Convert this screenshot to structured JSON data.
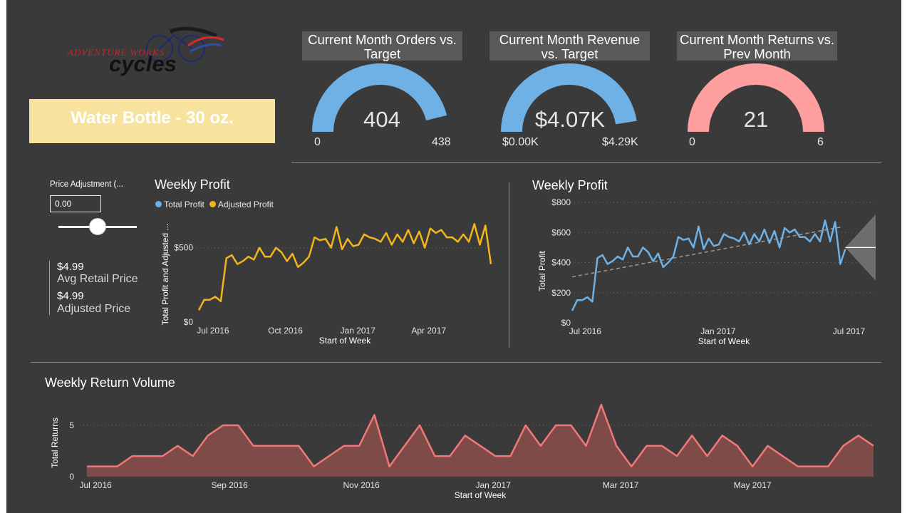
{
  "colors": {
    "background": "#3a3a3a",
    "orders_gauge": "#6fb1e4",
    "revenue_gauge": "#6fb1e4",
    "returns_gauge": "#ff9e9e",
    "banner": "#f8e39e",
    "adjusted_line": "#f2b51e",
    "total_line": "#6fb1e4",
    "returns_line": "#f07878",
    "returns_fill": "#7f4b48"
  },
  "logo": {
    "line1": "ADVENTURE WORKS",
    "line2": "cycles"
  },
  "banner": {
    "text": "Water Bottle - 30 oz."
  },
  "slicer": {
    "label": "Price Adjustment (...",
    "value": "0.00",
    "slider_fraction": 0.5
  },
  "cards": {
    "avg_retail_value": "$4.99",
    "avg_retail_label": "Avg Retail Price",
    "adjusted_value": "$4.99",
    "adjusted_label": "Adjusted Price"
  },
  "gauges": [
    {
      "title": "Current Month Orders vs. Target",
      "value_label": "404",
      "min_label": "0",
      "max_label": "438",
      "value": 404,
      "max": 438
    },
    {
      "title": "Current Month Revenue vs. Target",
      "value_label": "$4.07K",
      "min_label": "$0.00K",
      "max_label": "$4.29K",
      "value": 4.07,
      "max": 4.29
    },
    {
      "title": "Current Month Returns vs. Prev Month",
      "value_label": "21",
      "min_label": "0",
      "max_label": "6",
      "value": 21,
      "max": 6
    }
  ],
  "chart_data": [
    {
      "type": "line",
      "title": "Weekly Profit",
      "legend": [
        "Total Profit",
        "Adjusted Profit"
      ],
      "xlabel": "Start of Week",
      "ylabel": "Total Profit and Adjusted ...",
      "x_ticks": [
        "Jul 2016",
        "Oct 2016",
        "Jan 2017",
        "Apr 2017"
      ],
      "y_ticks": [
        "$0",
        "$500"
      ],
      "ylim": [
        0,
        700
      ],
      "x_range": [
        "2016-06-13",
        "2017-06-19"
      ],
      "x": [
        "2016-06-13",
        "2016-06-20",
        "2016-06-27",
        "2016-07-04",
        "2016-07-11",
        "2016-07-18",
        "2016-07-25",
        "2016-08-01",
        "2016-08-08",
        "2016-08-15",
        "2016-08-22",
        "2016-08-29",
        "2016-09-05",
        "2016-09-12",
        "2016-09-19",
        "2016-09-26",
        "2016-10-03",
        "2016-10-10",
        "2016-10-17",
        "2016-10-24",
        "2016-10-31",
        "2016-11-07",
        "2016-11-14",
        "2016-11-21",
        "2016-11-28",
        "2016-12-05",
        "2016-12-12",
        "2016-12-19",
        "2016-12-26",
        "2017-01-02",
        "2017-01-09",
        "2017-01-16",
        "2017-01-23",
        "2017-01-30",
        "2017-02-06",
        "2017-02-13",
        "2017-02-20",
        "2017-02-27",
        "2017-03-06",
        "2017-03-13",
        "2017-03-20",
        "2017-03-27",
        "2017-04-03",
        "2017-04-10",
        "2017-04-17",
        "2017-04-24",
        "2017-05-01",
        "2017-05-08",
        "2017-05-15",
        "2017-05-22",
        "2017-05-29",
        "2017-06-05",
        "2017-06-12",
        "2017-06-19"
      ],
      "series": [
        {
          "name": "Adjusted Profit",
          "values": [
            80,
            150,
            150,
            170,
            140,
            430,
            450,
            390,
            410,
            440,
            420,
            500,
            440,
            440,
            500,
            470,
            410,
            460,
            370,
            400,
            440,
            570,
            550,
            560,
            500,
            640,
            490,
            560,
            510,
            520,
            590,
            570,
            560,
            540,
            600,
            520,
            590,
            540,
            620,
            530,
            610,
            500,
            630,
            600,
            620,
            570,
            570,
            540,
            590,
            540,
            660,
            520,
            650,
            390
          ]
        }
      ]
    },
    {
      "type": "line",
      "title": "Weekly Profit",
      "xlabel": "Start of Week",
      "ylabel": "Total Profit",
      "x_ticks": [
        "Jul 2016",
        "Jan 2017",
        "Jul 2017"
      ],
      "y_ticks": [
        "$0",
        "$200",
        "$400",
        "$600",
        "$800"
      ],
      "ylim": [
        0,
        800
      ],
      "x_range": [
        "2016-06-13",
        "2017-08-07"
      ],
      "trendline": [
        {
          "x": "2016-06-13",
          "y": 305
        },
        {
          "x": "2017-06-19",
          "y": 635
        }
      ],
      "forecast": {
        "x_start": "2017-06-26",
        "x_end": "2017-08-07",
        "value": 500,
        "upper": 720,
        "lower": 280
      },
      "x": [
        "2016-06-13",
        "2016-06-20",
        "2016-06-27",
        "2016-07-04",
        "2016-07-11",
        "2016-07-18",
        "2016-07-25",
        "2016-08-01",
        "2016-08-08",
        "2016-08-15",
        "2016-08-22",
        "2016-08-29",
        "2016-09-05",
        "2016-09-12",
        "2016-09-19",
        "2016-09-26",
        "2016-10-03",
        "2016-10-10",
        "2016-10-17",
        "2016-10-24",
        "2016-10-31",
        "2016-11-07",
        "2016-11-14",
        "2016-11-21",
        "2016-11-28",
        "2016-12-05",
        "2016-12-12",
        "2016-12-19",
        "2016-12-26",
        "2017-01-02",
        "2017-01-09",
        "2017-01-16",
        "2017-01-23",
        "2017-01-30",
        "2017-02-06",
        "2017-02-13",
        "2017-02-20",
        "2017-02-27",
        "2017-03-06",
        "2017-03-13",
        "2017-03-20",
        "2017-03-27",
        "2017-04-03",
        "2017-04-10",
        "2017-04-17",
        "2017-04-24",
        "2017-05-01",
        "2017-05-08",
        "2017-05-15",
        "2017-05-22",
        "2017-05-29",
        "2017-06-05",
        "2017-06-12",
        "2017-06-19",
        "2017-06-26"
      ],
      "series": [
        {
          "name": "Total Profit",
          "values": [
            80,
            150,
            150,
            170,
            140,
            430,
            450,
            390,
            410,
            440,
            420,
            500,
            440,
            440,
            500,
            470,
            410,
            460,
            370,
            400,
            440,
            570,
            550,
            560,
            500,
            640,
            490,
            560,
            510,
            520,
            590,
            570,
            560,
            540,
            600,
            520,
            590,
            540,
            620,
            530,
            610,
            500,
            630,
            600,
            620,
            570,
            570,
            540,
            590,
            540,
            680,
            540,
            670,
            390,
            490
          ]
        }
      ]
    },
    {
      "type": "area",
      "title": "Weekly Return Volume",
      "xlabel": "Start of Week",
      "ylabel": "Total Returns",
      "x_ticks": [
        "Jul 2016",
        "Sep 2016",
        "Nov 2016",
        "Jan 2017",
        "Mar 2017",
        "May 2017"
      ],
      "y_ticks": [
        "0",
        "5"
      ],
      "ylim": [
        0,
        7
      ],
      "x_range": [
        "2016-06-27",
        "2017-06-26"
      ],
      "x": [
        "2016-06-27",
        "2016-07-04",
        "2016-07-11",
        "2016-07-18",
        "2016-07-25",
        "2016-08-01",
        "2016-08-08",
        "2016-08-15",
        "2016-08-22",
        "2016-08-29",
        "2016-09-05",
        "2016-09-12",
        "2016-09-19",
        "2016-09-26",
        "2016-10-03",
        "2016-10-10",
        "2016-10-17",
        "2016-10-24",
        "2016-10-31",
        "2016-11-07",
        "2016-11-14",
        "2016-11-21",
        "2016-11-28",
        "2016-12-05",
        "2016-12-12",
        "2016-12-19",
        "2016-12-26",
        "2017-01-02",
        "2017-01-09",
        "2017-01-16",
        "2017-01-23",
        "2017-01-30",
        "2017-02-06",
        "2017-02-13",
        "2017-02-20",
        "2017-02-27",
        "2017-03-06",
        "2017-03-13",
        "2017-03-20",
        "2017-03-27",
        "2017-04-03",
        "2017-04-10",
        "2017-04-17",
        "2017-04-24",
        "2017-05-01",
        "2017-05-08",
        "2017-05-15",
        "2017-05-22",
        "2017-05-29",
        "2017-06-05",
        "2017-06-12",
        "2017-06-19",
        "2017-06-26"
      ],
      "series": [
        {
          "name": "Total Returns",
          "values": [
            1,
            1,
            1,
            2,
            2,
            2,
            3,
            2,
            4,
            5,
            5,
            3,
            3,
            3,
            3,
            1,
            2,
            3,
            3,
            6,
            1,
            3,
            5,
            2,
            2,
            4,
            3,
            2,
            2,
            5,
            3,
            5,
            5,
            3,
            7,
            3,
            1,
            3,
            3,
            2,
            4,
            2,
            4,
            3,
            1,
            3,
            2,
            1,
            1,
            1,
            3,
            4,
            3
          ]
        }
      ]
    }
  ]
}
